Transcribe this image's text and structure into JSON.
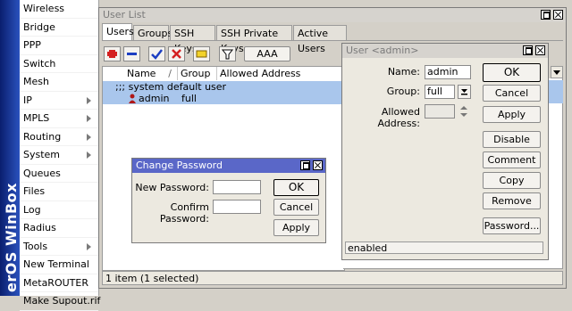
{
  "brand": "RouterOS WinBox",
  "brand_visible": "erOS WinBox",
  "menu": [
    {
      "label": "Wireless",
      "arrow": false
    },
    {
      "label": "Bridge",
      "arrow": false
    },
    {
      "label": "PPP",
      "arrow": false
    },
    {
      "label": "Switch",
      "arrow": false
    },
    {
      "label": "Mesh",
      "arrow": false
    },
    {
      "label": "IP",
      "arrow": true
    },
    {
      "label": "MPLS",
      "arrow": true
    },
    {
      "label": "Routing",
      "arrow": true
    },
    {
      "label": "System",
      "arrow": true
    },
    {
      "label": "Queues",
      "arrow": false
    },
    {
      "label": "Files",
      "arrow": false
    },
    {
      "label": "Log",
      "arrow": false
    },
    {
      "label": "Radius",
      "arrow": false
    },
    {
      "label": "Tools",
      "arrow": true
    },
    {
      "label": "New Terminal",
      "arrow": false
    },
    {
      "label": "MetaROUTER",
      "arrow": false
    },
    {
      "label": "Make Supout.rif",
      "arrow": false
    }
  ],
  "user_list": {
    "title": "User List",
    "tabs": [
      "Users",
      "Groups",
      "SSH Keys",
      "SSH Private Keys",
      "Active Users"
    ],
    "aaa_label": "AAA",
    "columns": [
      "Name",
      "Group",
      "Allowed Address"
    ],
    "comment_row": ";;; system default user",
    "rows": [
      {
        "name": "admin",
        "group": "full",
        "allowed_address": ""
      }
    ],
    "status": "1 item (1 selected)"
  },
  "user_dialog": {
    "title": "User <admin>",
    "name_label": "Name:",
    "name_value": "admin",
    "group_label": "Group:",
    "group_value": "full",
    "allowed_label": "Allowed Address:",
    "allowed_value": "",
    "buttons": {
      "ok": "OK",
      "cancel": "Cancel",
      "apply": "Apply",
      "disable": "Disable",
      "comment": "Comment",
      "copy": "Copy",
      "remove": "Remove",
      "password": "Password..."
    },
    "status": "enabled"
  },
  "change_password": {
    "title": "Change Password",
    "new_label": "New Password:",
    "confirm_label": "Confirm Password:",
    "new_value": "",
    "confirm_value": "",
    "buttons": {
      "ok": "OK",
      "cancel": "Cancel",
      "apply": "Apply"
    }
  },
  "colors": {
    "active_title": "#5a67c8",
    "selection": "#a9c6ec",
    "strip": "#0a1e6e",
    "add": "#d42020",
    "check": "#1c3ec2"
  },
  "icons": [
    "add-icon",
    "remove-icon",
    "enable-check-icon",
    "disable-x-icon",
    "comment-icon",
    "filter-icon",
    "user-icon",
    "dropdown-arrow-icon",
    "stepper-icon"
  ]
}
